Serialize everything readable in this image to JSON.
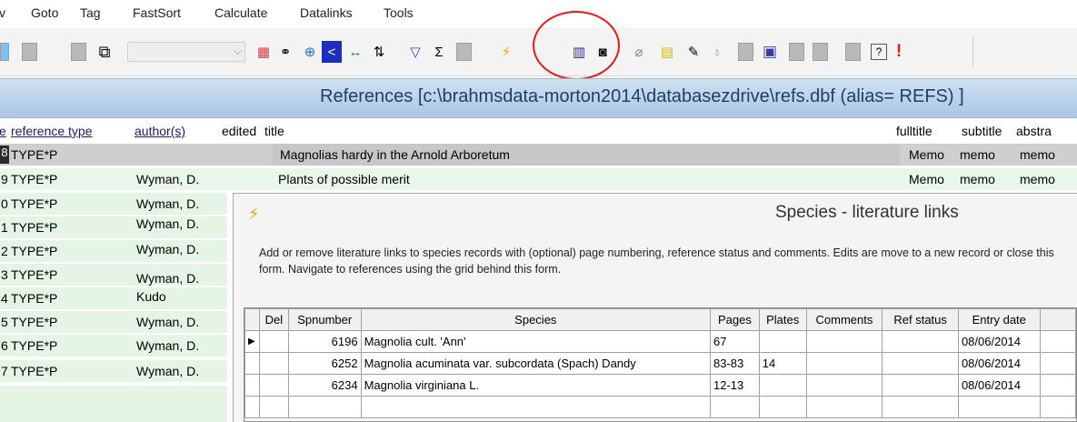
{
  "menu": {
    "items": [
      "v",
      "Goto",
      "Tag",
      "FastSort",
      "Calculate",
      "Datalinks",
      "Tools"
    ]
  },
  "toolbar": {
    "icons": [
      "table-icon",
      "binoculars-icon",
      "zoom-in-icon",
      "back-icon",
      "resize-icon",
      "sort-icon",
      "filter-icon",
      "sigma-icon",
      "lightning-icon",
      "books-icon",
      "camera-icon",
      "paperclip-icon",
      "notepad-icon",
      "edit-icon",
      "bulb-icon",
      "save-icon",
      "help-icon",
      "alert-icon"
    ],
    "sigma": "Σ",
    "help": "?",
    "alert": "!",
    "highlight_color": "#e21b1b"
  },
  "window": {
    "title": "References [c:\\brahmsdata-morton2014\\databasezdrive\\refs.dbf (alias= REFS) ]"
  },
  "grid": {
    "headers": [
      "e",
      "reference type",
      "author(s)",
      "edited",
      "title",
      "fulltitle",
      "subtitle",
      "abstra"
    ],
    "rows": [
      {
        "id": "8",
        "type": "TYPE*P",
        "author": "",
        "title": "Magnolias hardy in the Arnold Arboretum",
        "fulltitle": "Memo",
        "subtitle": "memo",
        "abstract": "memo"
      },
      {
        "id": "9",
        "type": "TYPE*P",
        "author": "Wyman, D.",
        "title": "Plants of possible merit",
        "fulltitle": "Memo",
        "subtitle": "memo",
        "abstract": "memo"
      },
      {
        "id": "0",
        "type": "TYPE*P",
        "author": "Wyman, D."
      },
      {
        "id": "1",
        "type": "TYPE*P",
        "author": "Wyman, D."
      },
      {
        "id": "2",
        "type": "TYPE*P",
        "author": "Wyman, D."
      },
      {
        "id": "3",
        "type": "TYPE*P",
        "author": "Wyman, D."
      },
      {
        "id": "4",
        "type": "TYPE*P",
        "author": "Kudo"
      },
      {
        "id": "5",
        "type": "TYPE*P",
        "author": "Wyman, D."
      },
      {
        "id": "6",
        "type": "TYPE*P",
        "author": "Wyman, D."
      },
      {
        "id": "7",
        "type": "TYPE*P",
        "author": "Wyman, D."
      }
    ]
  },
  "dialog": {
    "title": "Species - literature links",
    "description": "Add or remove literature links to species records with (optional) page numbering, reference status and comments. Edits are move to a new record or close this form. Navigate to references using the grid behind this form.",
    "columns": [
      "Del",
      "Spnumber",
      "Species",
      "Pages",
      "Plates",
      "Comments",
      "Ref status",
      "Entry date"
    ],
    "rows": [
      {
        "spnumber": "6196",
        "species": "Magnolia  cult. 'Ann'",
        "pages": "67",
        "plates": "",
        "comments": "",
        "ref_status": "",
        "entry_date": "08/06/2014"
      },
      {
        "spnumber": "6252",
        "species": "Magnolia acuminata  var. subcordata (Spach) Dandy",
        "pages": "83-83",
        "plates": "14",
        "comments": "",
        "ref_status": "",
        "entry_date": "08/06/2014"
      },
      {
        "spnumber": "6234",
        "species": "Magnolia virginiana L.",
        "pages": "12-13",
        "plates": "",
        "comments": "",
        "ref_status": "",
        "entry_date": "08/06/2014"
      }
    ]
  }
}
